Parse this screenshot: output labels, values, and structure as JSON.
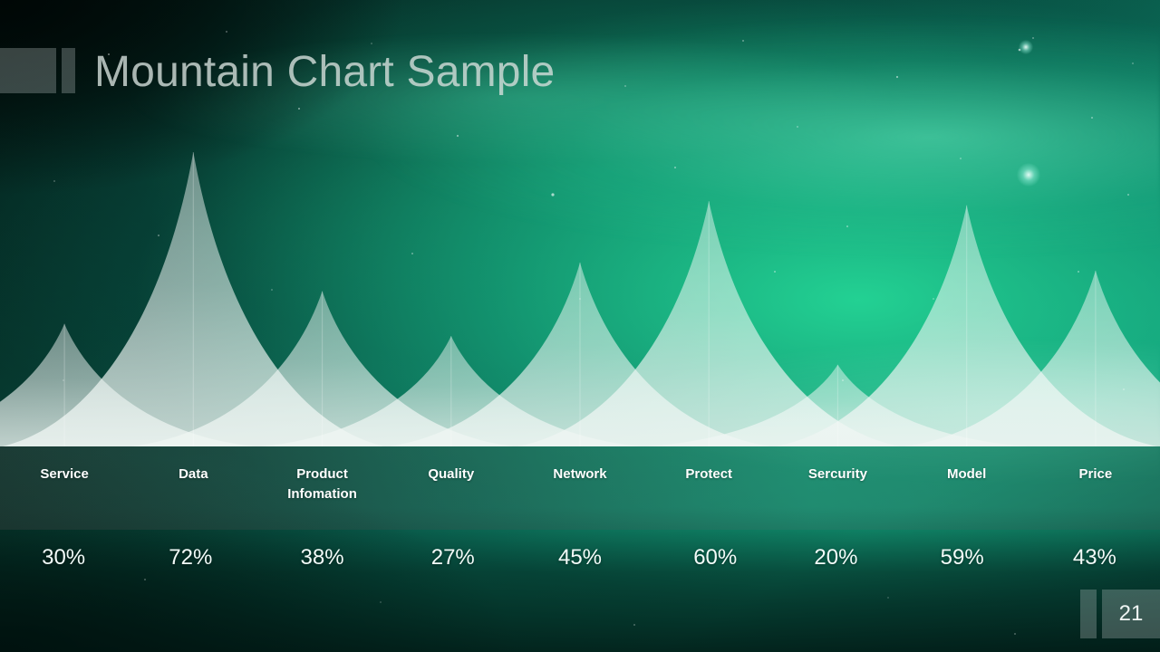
{
  "slide": {
    "title": "Mountain Chart Sample",
    "page_number": "21",
    "theme": {
      "accent": "#14a37f",
      "background_dark": "#05231c",
      "mountain_fill": "#e9f2ef",
      "text_on_band": "#ffffff"
    }
  },
  "chart_data": {
    "type": "area",
    "title": "Mountain Chart Sample",
    "xlabel": "",
    "ylabel": "",
    "ylim": [
      0,
      100
    ],
    "grid": false,
    "legend": "none",
    "unit": "%",
    "categories": [
      "Service",
      "Data",
      "Product Infomation",
      "Quality",
      "Network",
      "Protect",
      "Sercurity",
      "Model",
      "Price"
    ],
    "values": [
      30,
      72,
      38,
      27,
      45,
      60,
      20,
      59,
      43
    ],
    "value_labels": [
      "30%",
      "72%",
      "38%",
      "27%",
      "45%",
      "60%",
      "20%",
      "59%",
      "43%"
    ]
  },
  "categories": [
    {
      "label_line1": "Service",
      "label_line2": "",
      "value": "30%"
    },
    {
      "label_line1": "Data",
      "label_line2": "",
      "value": "72%"
    },
    {
      "label_line1": "Product",
      "label_line2": "Infomation",
      "value": "38%"
    },
    {
      "label_line1": "Quality",
      "label_line2": "",
      "value": "27%"
    },
    {
      "label_line1": "Network",
      "label_line2": "",
      "value": "45%"
    },
    {
      "label_line1": "Protect",
      "label_line2": "",
      "value": "60%"
    },
    {
      "label_line1": "Sercurity",
      "label_line2": "",
      "value": "20%"
    },
    {
      "label_line1": "Model",
      "label_line2": "",
      "value": "59%"
    },
    {
      "label_line1": "Price",
      "label_line2": "",
      "value": "43%"
    }
  ]
}
